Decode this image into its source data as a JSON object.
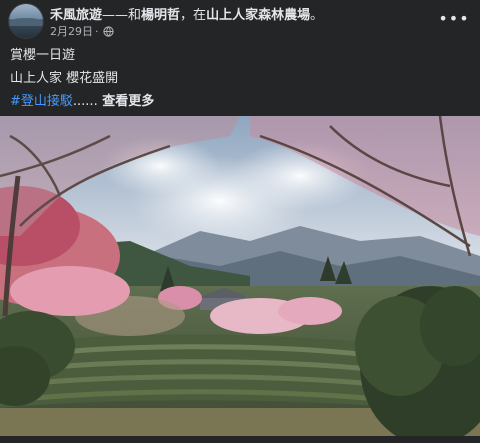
{
  "post": {
    "author": "禾風旅遊",
    "with_separator": "——和",
    "tagged_person": "楊明哲",
    "at_separator": "，在",
    "location": "山上人家森林農場",
    "location_end": "。",
    "date": "2月29日",
    "dot": " · ",
    "audience_icon": "globe-icon",
    "more_label": "•••",
    "text_line1": "賞櫻一日遊",
    "text_line2": "山上人家 櫻花盛開",
    "hashtag": "#登山接駁",
    "ellipsis": "......",
    "see_more": " 查看更多",
    "photo_subject": "cherry-blossom-tea-plantation"
  },
  "colors": {
    "background": "#242526",
    "text": "#e4e6eb",
    "secondary_text": "#b0b3b8",
    "link": "#4599ff"
  }
}
